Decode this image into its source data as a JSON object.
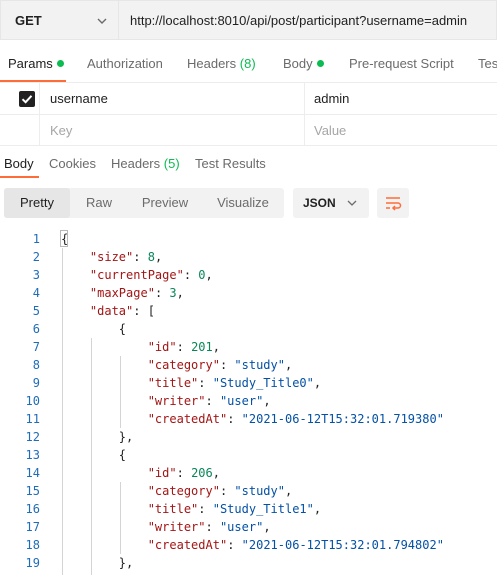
{
  "request": {
    "method": "GET",
    "url": "http://localhost:8010/api/post/participant?username=admin"
  },
  "request_tabs": [
    {
      "label": "Params",
      "dot": true,
      "count": ""
    },
    {
      "label": "Authorization",
      "dot": false,
      "count": ""
    },
    {
      "label": "Headers",
      "dot": false,
      "count": "(8)"
    },
    {
      "label": "Body",
      "dot": true,
      "count": ""
    },
    {
      "label": "Pre-request Script",
      "dot": false,
      "count": ""
    },
    {
      "label": "Tes",
      "dot": false,
      "count": ""
    }
  ],
  "params": {
    "rows": [
      {
        "checked": true,
        "key": "username",
        "value": "admin"
      }
    ],
    "key_placeholder": "Key",
    "value_placeholder": "Value"
  },
  "response_tabs": [
    {
      "label": "Body",
      "count": ""
    },
    {
      "label": "Cookies",
      "count": ""
    },
    {
      "label": "Headers",
      "count": "(5)"
    },
    {
      "label": "Test Results",
      "count": ""
    }
  ],
  "view_modes": [
    "Pretty",
    "Raw",
    "Preview",
    "Visualize"
  ],
  "format": "JSON",
  "code_lines": [
    {
      "n": "1",
      "t": [
        [
          "p",
          "{"
        ]
      ]
    },
    {
      "n": "2",
      "t": [
        [
          "p",
          "    "
        ],
        [
          "k",
          "\"size\""
        ],
        [
          "p",
          ": "
        ],
        [
          "n",
          "8"
        ],
        [
          "p",
          ","
        ]
      ]
    },
    {
      "n": "3",
      "t": [
        [
          "p",
          "    "
        ],
        [
          "k",
          "\"currentPage\""
        ],
        [
          "p",
          ": "
        ],
        [
          "n",
          "0"
        ],
        [
          "p",
          ","
        ]
      ]
    },
    {
      "n": "4",
      "t": [
        [
          "p",
          "    "
        ],
        [
          "k",
          "\"maxPage\""
        ],
        [
          "p",
          ": "
        ],
        [
          "n",
          "3"
        ],
        [
          "p",
          ","
        ]
      ]
    },
    {
      "n": "5",
      "t": [
        [
          "p",
          "    "
        ],
        [
          "k",
          "\"data\""
        ],
        [
          "p",
          ": ["
        ]
      ]
    },
    {
      "n": "6",
      "t": [
        [
          "p",
          "        {"
        ]
      ]
    },
    {
      "n": "7",
      "t": [
        [
          "p",
          "            "
        ],
        [
          "k",
          "\"id\""
        ],
        [
          "p",
          ": "
        ],
        [
          "n",
          "201"
        ],
        [
          "p",
          ","
        ]
      ]
    },
    {
      "n": "8",
      "t": [
        [
          "p",
          "            "
        ],
        [
          "k",
          "\"category\""
        ],
        [
          "p",
          ": "
        ],
        [
          "s",
          "\"study\""
        ],
        [
          "p",
          ","
        ]
      ]
    },
    {
      "n": "9",
      "t": [
        [
          "p",
          "            "
        ],
        [
          "k",
          "\"title\""
        ],
        [
          "p",
          ": "
        ],
        [
          "s",
          "\"Study_Title0\""
        ],
        [
          "p",
          ","
        ]
      ]
    },
    {
      "n": "10",
      "t": [
        [
          "p",
          "            "
        ],
        [
          "k",
          "\"writer\""
        ],
        [
          "p",
          ": "
        ],
        [
          "s",
          "\"user\""
        ],
        [
          "p",
          ","
        ]
      ]
    },
    {
      "n": "11",
      "t": [
        [
          "p",
          "            "
        ],
        [
          "k",
          "\"createdAt\""
        ],
        [
          "p",
          ": "
        ],
        [
          "s",
          "\"2021-06-12T15:32:01.719380\""
        ]
      ]
    },
    {
      "n": "12",
      "t": [
        [
          "p",
          "        },"
        ]
      ]
    },
    {
      "n": "13",
      "t": [
        [
          "p",
          "        {"
        ]
      ]
    },
    {
      "n": "14",
      "t": [
        [
          "p",
          "            "
        ],
        [
          "k",
          "\"id\""
        ],
        [
          "p",
          ": "
        ],
        [
          "n",
          "206"
        ],
        [
          "p",
          ","
        ]
      ]
    },
    {
      "n": "15",
      "t": [
        [
          "p",
          "            "
        ],
        [
          "k",
          "\"category\""
        ],
        [
          "p",
          ": "
        ],
        [
          "s",
          "\"study\""
        ],
        [
          "p",
          ","
        ]
      ]
    },
    {
      "n": "16",
      "t": [
        [
          "p",
          "            "
        ],
        [
          "k",
          "\"title\""
        ],
        [
          "p",
          ": "
        ],
        [
          "s",
          "\"Study_Title1\""
        ],
        [
          "p",
          ","
        ]
      ]
    },
    {
      "n": "17",
      "t": [
        [
          "p",
          "            "
        ],
        [
          "k",
          "\"writer\""
        ],
        [
          "p",
          ": "
        ],
        [
          "s",
          "\"user\""
        ],
        [
          "p",
          ","
        ]
      ]
    },
    {
      "n": "18",
      "t": [
        [
          "p",
          "            "
        ],
        [
          "k",
          "\"createdAt\""
        ],
        [
          "p",
          ": "
        ],
        [
          "s",
          "\"2021-06-12T15:32:01.794802\""
        ]
      ]
    },
    {
      "n": "19",
      "t": [
        [
          "p",
          "        },"
        ]
      ]
    }
  ],
  "colors": {
    "accent": "#ff6c37",
    "green": "#0cbb52",
    "key": "#a31515",
    "string": "#0451a5",
    "number": "#098658",
    "line_number": "#1f6db8"
  },
  "icons": {
    "method_dropdown": "chevron-down-icon",
    "format_dropdown": "chevron-down-icon",
    "wrap": "wrap-lines-icon",
    "checkbox": "checkmark-icon"
  }
}
